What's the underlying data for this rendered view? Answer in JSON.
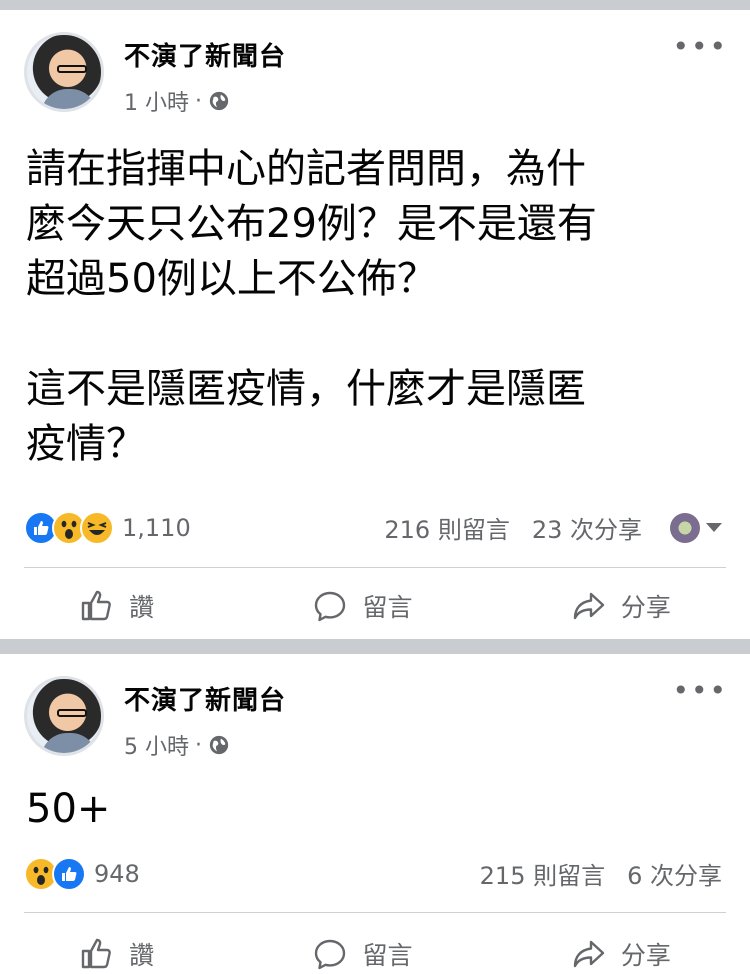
{
  "posts": [
    {
      "page_name": "不演了新聞台",
      "time": "1 小時",
      "separator": "·",
      "text": "請在指揮中心的記者問問，為什\n麼今天只公布29例？是不是還有\n超過50例以上不公佈？\n\n這不是隱匿疫情，什麼才是隱匿\n疫情？",
      "reaction_icons": [
        "like-icon",
        "wow-icon",
        "haha-icon"
      ],
      "reaction_count": "1,110",
      "comments": "216 則留言",
      "shares": "23 次分享"
    },
    {
      "page_name": "不演了新聞台",
      "time": "5 小時",
      "separator": "·",
      "text": "50+",
      "reaction_icons": [
        "wow-icon",
        "like-icon"
      ],
      "reaction_count": "948",
      "comments": "215 則留言",
      "shares": "6 次分享"
    }
  ],
  "actions": {
    "like": "讚",
    "comment": "留言",
    "share": "分享"
  },
  "colors": {
    "like_blue": "#1877f2",
    "reaction_yellow": "#f7b928",
    "secondary_text": "#65676b",
    "separator_bg": "#c9ccd1"
  }
}
